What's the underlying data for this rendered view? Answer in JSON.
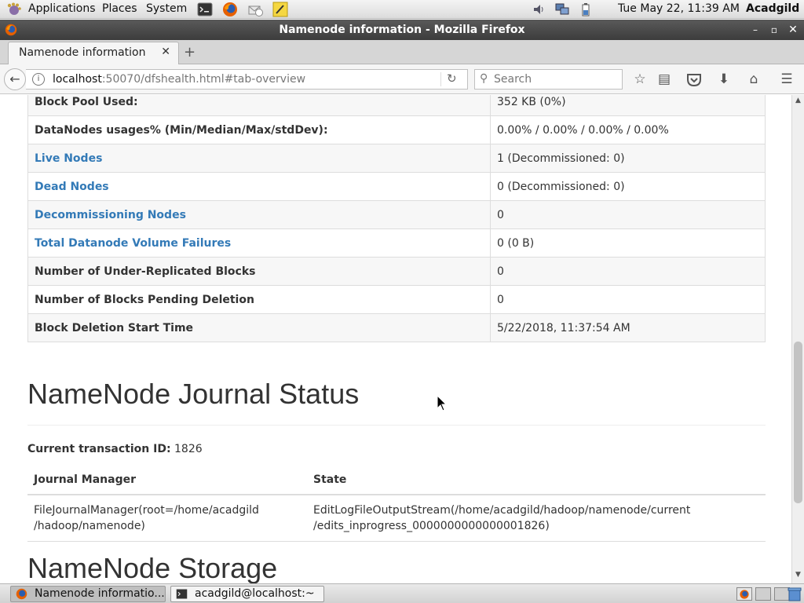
{
  "panel": {
    "menus": [
      "Applications",
      "Places",
      "System"
    ],
    "clock": "Tue May 22, 11:39 AM",
    "user": "Acadgild"
  },
  "window": {
    "title": "Namenode information - Mozilla Firefox"
  },
  "browser": {
    "tab_title": "Namenode information",
    "url_host": "localhost",
    "url_rest": ":50070/dfshealth.html#tab-overview",
    "search_placeholder": "Search"
  },
  "summary_rows": [
    {
      "label": "Block Pool Used:",
      "value": "352 KB (0%)",
      "link": false
    },
    {
      "label": "DataNodes usages% (Min/Median/Max/stdDev):",
      "value": "0.00% / 0.00% / 0.00% / 0.00%",
      "link": false
    },
    {
      "label": "Live Nodes",
      "value": "1 (Decommissioned: 0)",
      "link": true
    },
    {
      "label": "Dead Nodes",
      "value": "0 (Decommissioned: 0)",
      "link": true
    },
    {
      "label": "Decommissioning Nodes",
      "value": "0",
      "link": true
    },
    {
      "label": "Total Datanode Volume Failures",
      "value": "0 (0 B)",
      "link": true
    },
    {
      "label": "Number of Under-Replicated Blocks",
      "value": "0",
      "link": false
    },
    {
      "label": "Number of Blocks Pending Deletion",
      "value": "0",
      "link": false
    },
    {
      "label": "Block Deletion Start Time",
      "value": "5/22/2018, 11:37:54 AM",
      "link": false
    }
  ],
  "journal": {
    "heading": "NameNode Journal Status",
    "txid_label": "Current transaction ID:",
    "txid_value": "1826",
    "columns": [
      "Journal Manager",
      "State"
    ],
    "manager_lines": [
      "FileJournalManager(root=/home/acadgild",
      "/hadoop/namenode)"
    ],
    "state_lines": [
      "EditLogFileOutputStream(/home/acadgild/hadoop/namenode/current",
      "/edits_inprogress_0000000000000001826)"
    ]
  },
  "storage_heading": "NameNode Storage",
  "taskbar": {
    "firefox_label": "Namenode informatio...",
    "terminal_label": "acadgild@localhost:~"
  },
  "colors": {
    "link": "#337ab7",
    "titlebar": "#4a4a4a"
  }
}
